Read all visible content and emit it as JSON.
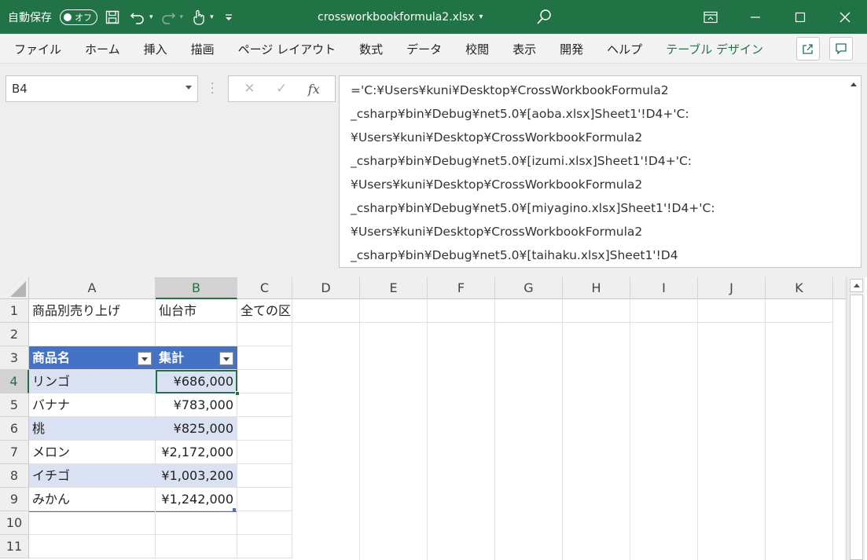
{
  "titlebar": {
    "autosave_label": "自動保存",
    "autosave_state": "オフ",
    "filename": "crossworkbookformula2.xlsx",
    "filename_caret": "▾",
    "undo_caret": "▾",
    "redo_caret": "▾",
    "touch_caret": "▾"
  },
  "ribbon": {
    "tabs": [
      "ファイル",
      "ホーム",
      "挿入",
      "描画",
      "ページ レイアウト",
      "数式",
      "データ",
      "校閲",
      "表示",
      "開発",
      "ヘルプ",
      "テーブル デザイン"
    ]
  },
  "formula_bar": {
    "name_box": "B4",
    "cancel_glyph": "✕",
    "enter_glyph": "✓",
    "fx_label": "fx",
    "lines": [
      "='C:¥Users¥kuni¥Desktop¥CrossWorkbookFormula2",
      "_csharp¥bin¥Debug¥net5.0¥[aoba.xlsx]Sheet1'!D4+'C:",
      "¥Users¥kuni¥Desktop¥CrossWorkbookFormula2",
      "_csharp¥bin¥Debug¥net5.0¥[izumi.xlsx]Sheet1'!D4+'C:",
      "¥Users¥kuni¥Desktop¥CrossWorkbookFormula2",
      "_csharp¥bin¥Debug¥net5.0¥[miyagino.xlsx]Sheet1'!D4+'C:",
      "¥Users¥kuni¥Desktop¥CrossWorkbookFormula2",
      "_csharp¥bin¥Debug¥net5.0¥[taihaku.xlsx]Sheet1'!D4"
    ]
  },
  "sheet": {
    "columns": [
      "A",
      "B",
      "C",
      "D",
      "E",
      "F",
      "G",
      "H",
      "I",
      "J",
      "K"
    ],
    "rows": [
      "1",
      "2",
      "3",
      "4",
      "5",
      "6",
      "7",
      "8",
      "9",
      "10",
      "11"
    ],
    "selected_cell": "B4",
    "cells": {
      "A1": "商品別売り上げ",
      "B1": "仙台市",
      "C1": "全ての区"
    },
    "table": {
      "headers": [
        "商品名",
        "集計"
      ],
      "rows": [
        [
          "リンゴ",
          "¥686,000"
        ],
        [
          "バナナ",
          "¥783,000"
        ],
        [
          "桃",
          "¥825,000"
        ],
        [
          "メロン",
          "¥2,172,000"
        ],
        [
          "イチゴ",
          "¥1,003,200"
        ],
        [
          "みかん",
          "¥1,242,000"
        ]
      ]
    }
  },
  "colors": {
    "excel_green": "#217346",
    "table_header": "#4472c4",
    "table_band": "#d9e1f2"
  }
}
